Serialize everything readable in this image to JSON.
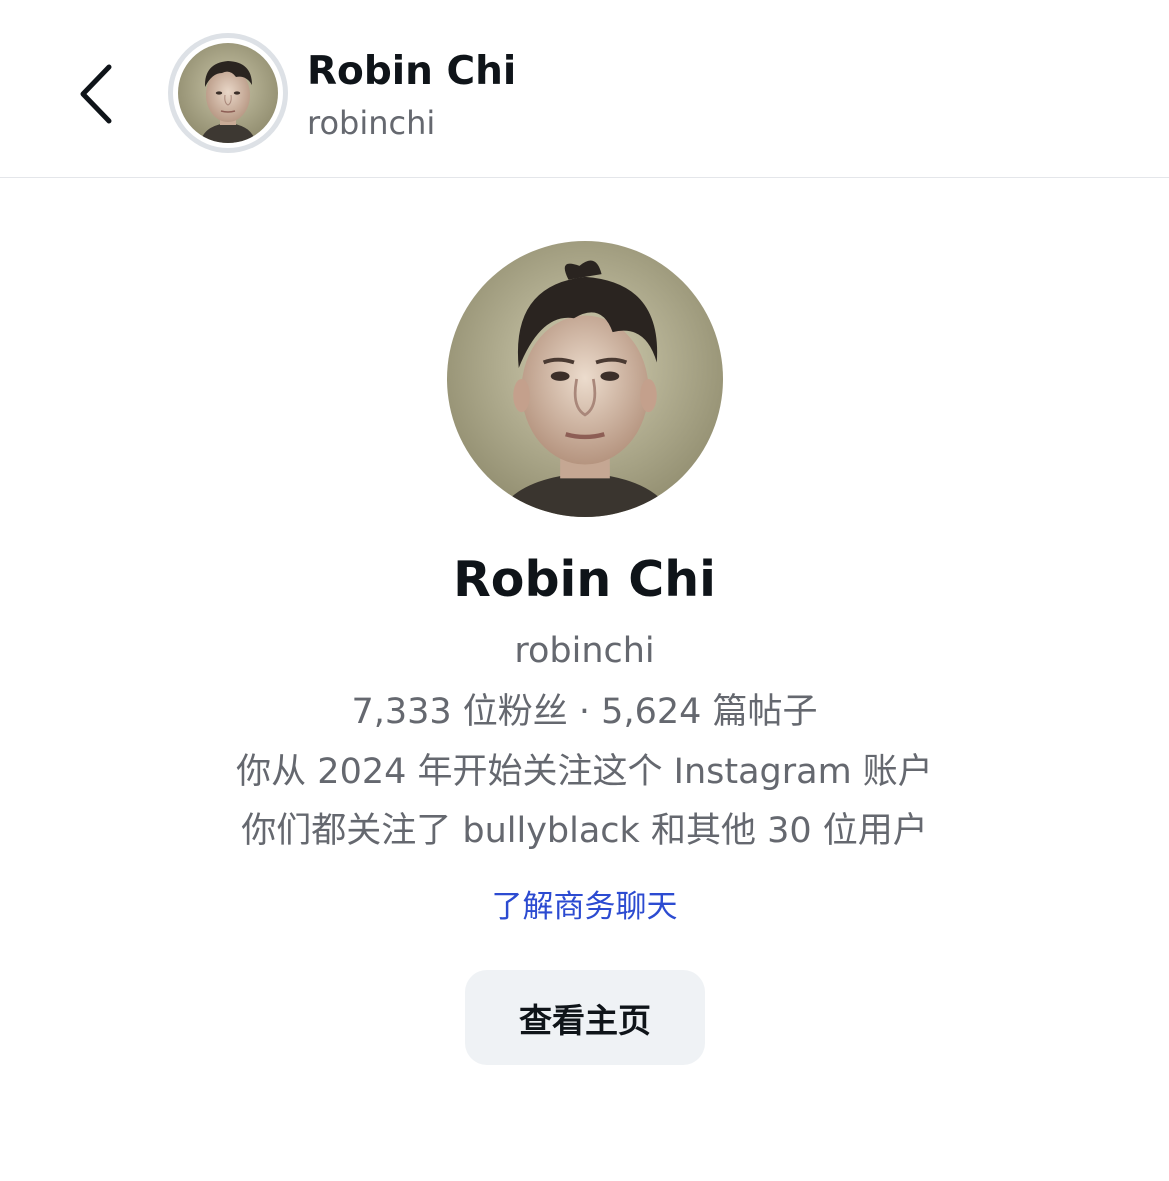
{
  "header": {
    "name": "Robin Chi",
    "handle": "robinchi"
  },
  "profile": {
    "name": "Robin Chi",
    "handle": "robinchi",
    "stats": "7,333 位粉丝 · 5,624 篇帖子",
    "follow_since": "你从 2024 年开始关注这个 Instagram 账户",
    "mutuals": "你们都关注了 bullyblack 和其他 30 位用户",
    "business_chat_link": "了解商务聊天",
    "view_profile_button": "查看主页"
  },
  "icons": {
    "back": "chevron-left-icon",
    "avatar": "avatar"
  },
  "colors": {
    "text_primary": "#0f1419",
    "text_secondary": "#65686f",
    "link": "#2c4bd1",
    "button_bg": "#eff2f5",
    "divider": "#e4e6ea"
  }
}
